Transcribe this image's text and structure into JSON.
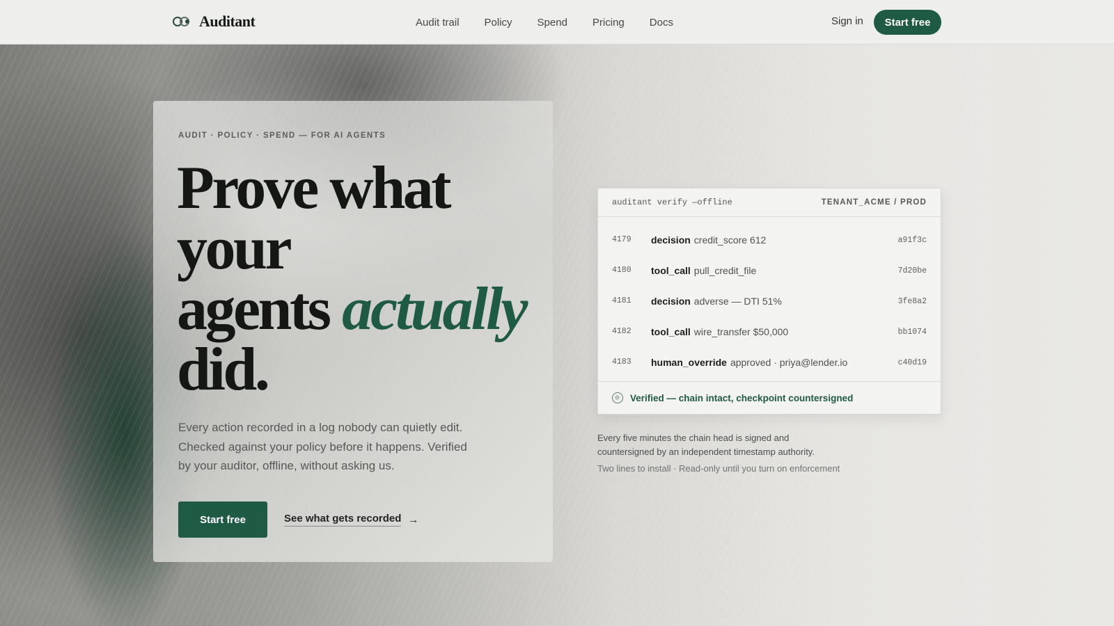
{
  "nav": {
    "brand": "Auditant",
    "links": [
      "Audit trail",
      "Policy",
      "Spend",
      "Pricing",
      "Docs"
    ],
    "sign_in": "Sign in",
    "cta": "Start free"
  },
  "hero": {
    "eyebrow": "AUDIT · POLICY · SPEND — FOR AI AGENTS",
    "headline_line1": "Prove what",
    "headline_line2": "your",
    "headline_line3": "agents",
    "headline_accent": "actually",
    "headline_line4": "did.",
    "lede": "Every action recorded in a log nobody can quietly edit. Checked against your policy before it happens. Verified by your auditor, offline, without asking us.",
    "primary_cta": "Start free",
    "secondary_cta": "See what gets recorded",
    "secondary_icon": "arrow-right-icon"
  },
  "panel": {
    "command": "auditant verify —offline",
    "tenant": "TENANT_ACME / PROD",
    "rows": [
      {
        "id": "4179",
        "kind": "decision",
        "detail": "credit_score 612",
        "hash": "a91f3c"
      },
      {
        "id": "4180",
        "kind": "tool_call",
        "detail": "pull_credit_file",
        "hash": "7d20be"
      },
      {
        "id": "4181",
        "kind": "decision",
        "detail": "adverse — DTI 51%",
        "hash": "3fe8a2"
      },
      {
        "id": "4182",
        "kind": "tool_call",
        "detail": "wire_transfer $50,000",
        "hash": "bb1074"
      },
      {
        "id": "4183",
        "kind": "human_override",
        "detail": "approved · priya@lender.io",
        "hash": "c40d19"
      }
    ],
    "status": "Verified — chain intact, checkpoint countersigned",
    "status_icon": "check-circle-icon"
  },
  "note": "Every five minutes the chain head is signed and countersigned by an independent timestamp authority.",
  "subnote": "Two lines to install · Read-only until you turn on enforcement",
  "colors": {
    "brand_green": "#1f5a45",
    "text_dark": "#141714",
    "panel_bg": "#f3f3f1"
  }
}
